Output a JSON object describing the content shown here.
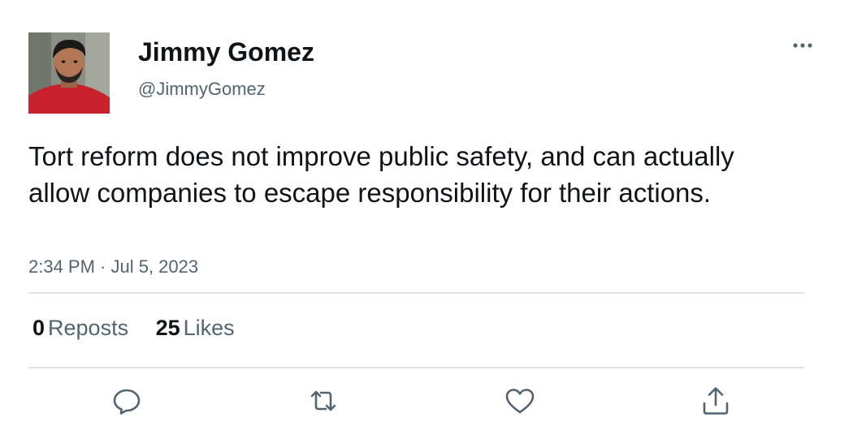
{
  "author": {
    "display_name": "Jimmy Gomez",
    "handle": "@JimmyGomez"
  },
  "tweet": {
    "text": "Tort reform does not improve public safety, and can actually allow companies to escape responsibility for their actions.",
    "timestamp": "2:34 PM · Jul 5, 2023"
  },
  "stats": {
    "reposts_count": "0",
    "reposts_label": "Reposts",
    "likes_count": "25",
    "likes_label": "Likes"
  },
  "icons": {
    "more": "more-horizontal-icon",
    "reply": "reply-icon",
    "repost": "repost-icon",
    "like": "heart-icon",
    "share": "share-icon"
  },
  "colors": {
    "text_primary": "#0f1419",
    "text_secondary": "#536471",
    "divider": "#dfe3e6"
  }
}
